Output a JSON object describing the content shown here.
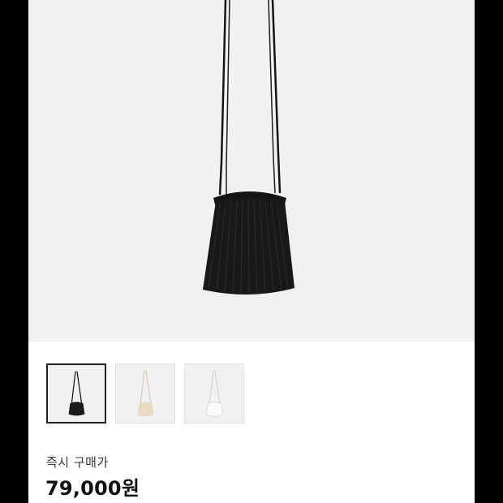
{
  "product": {
    "image_name": "black-pleated-drawstring-bag",
    "thumbnails": [
      {
        "name": "thumb-black",
        "color": "#1a1a1a",
        "strap_color": "#111111",
        "selected": true
      },
      {
        "name": "thumb-beige",
        "color": "#e9d9c3",
        "strap_color": "#e0d6c8",
        "selected": false
      },
      {
        "name": "thumb-white",
        "color": "#f6f6f6",
        "strap_color": "#e6e6e6",
        "selected": false
      }
    ]
  },
  "pricing": {
    "label": "즉시 구매가",
    "value": "79,000원"
  },
  "colors": {
    "hero_bg": "#f1f1f1",
    "text_primary": "#111111",
    "text_secondary": "#333333"
  }
}
